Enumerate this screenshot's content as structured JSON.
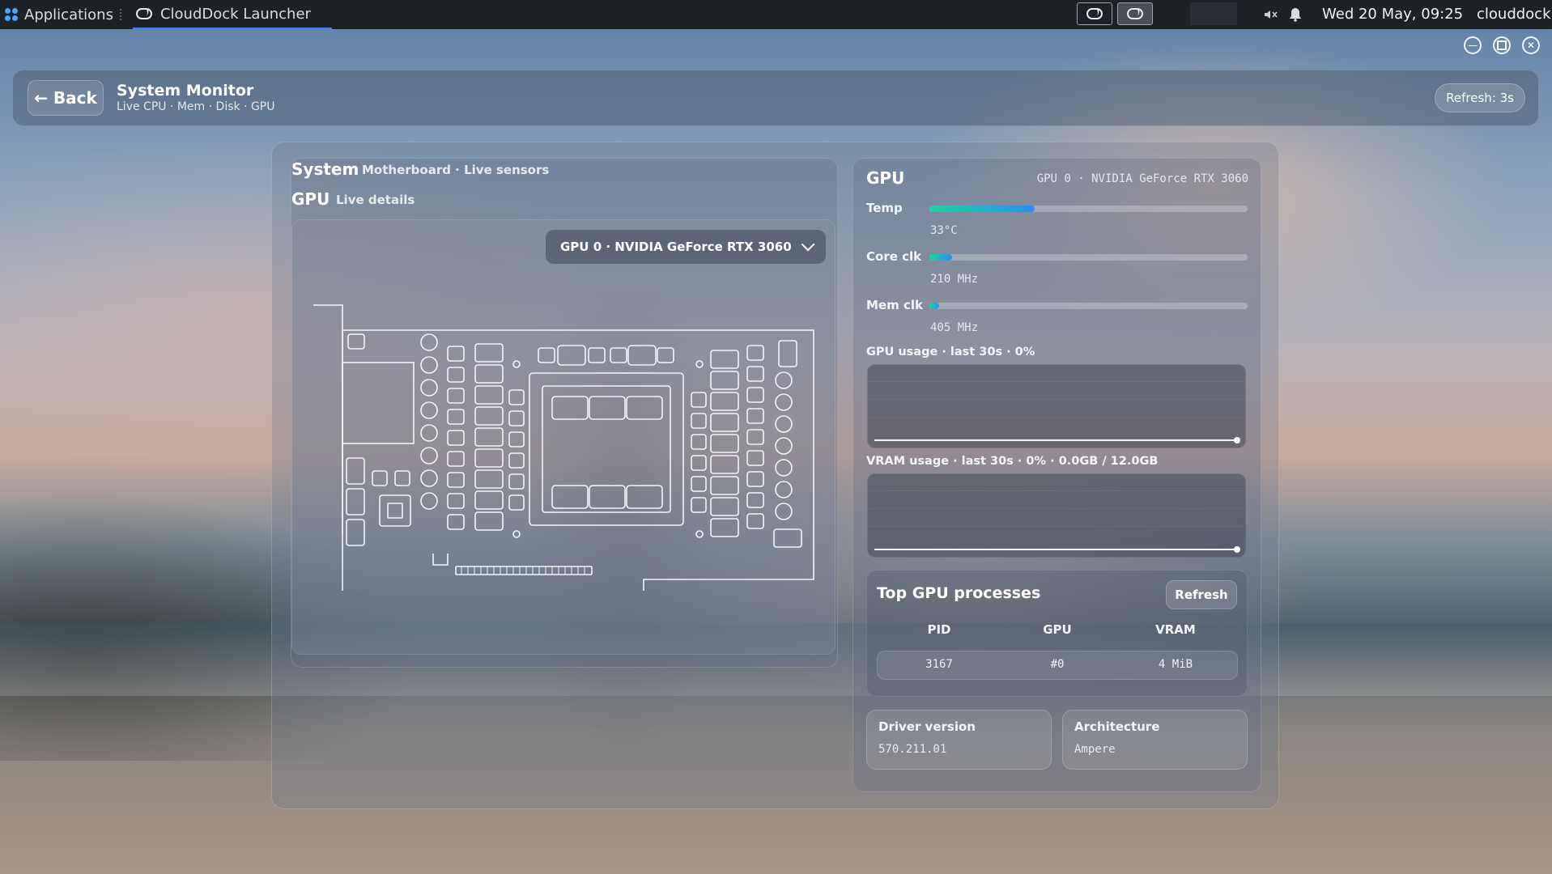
{
  "taskbar": {
    "applications_label": "Applications",
    "active_task": "CloudDock Launcher",
    "clock": "Wed 20 May, 09:25",
    "user": "clouddock"
  },
  "header": {
    "back_label": "← Back",
    "title": "System Monitor",
    "subtitle": "Live CPU · Mem · Disk · GPU",
    "refresh_label": "Refresh: 3s"
  },
  "left": {
    "system_title": "System",
    "system_sub": "Motherboard · Live sensors",
    "gpu_title": "GPU",
    "gpu_sub": "Live details",
    "gpu_select_value": "GPU 0 · NVIDIA GeForce RTX 3060"
  },
  "right": {
    "title": "GPU",
    "model": "GPU 0 · NVIDIA GeForce RTX 3060",
    "metrics": [
      {
        "label": "Temp",
        "value": "33°C",
        "fill_pct": 33
      },
      {
        "label": "Core clk",
        "value": "210 MHz",
        "fill_pct": 7
      },
      {
        "label": "Mem clk",
        "value": "405 MHz",
        "fill_pct": 3
      }
    ],
    "gpu_usage_label": "GPU usage · last 30s · 0%",
    "vram_usage_label": "VRAM usage · last 30s · 0% · 0.0GB / 12.0GB",
    "processes": {
      "title": "Top GPU processes",
      "refresh_label": "Refresh",
      "columns": [
        "PID",
        "GPU",
        "VRAM"
      ],
      "rows": [
        [
          "3167",
          "#0",
          "4 MiB"
        ]
      ]
    },
    "driver_label": "Driver version",
    "driver_value": "570.211.01",
    "arch_label": "Architecture",
    "arch_value": "Ampere"
  },
  "colors": {
    "accent": "#3b82f6",
    "bar_start": "#20d39c",
    "bar_end": "#2a8df5"
  }
}
